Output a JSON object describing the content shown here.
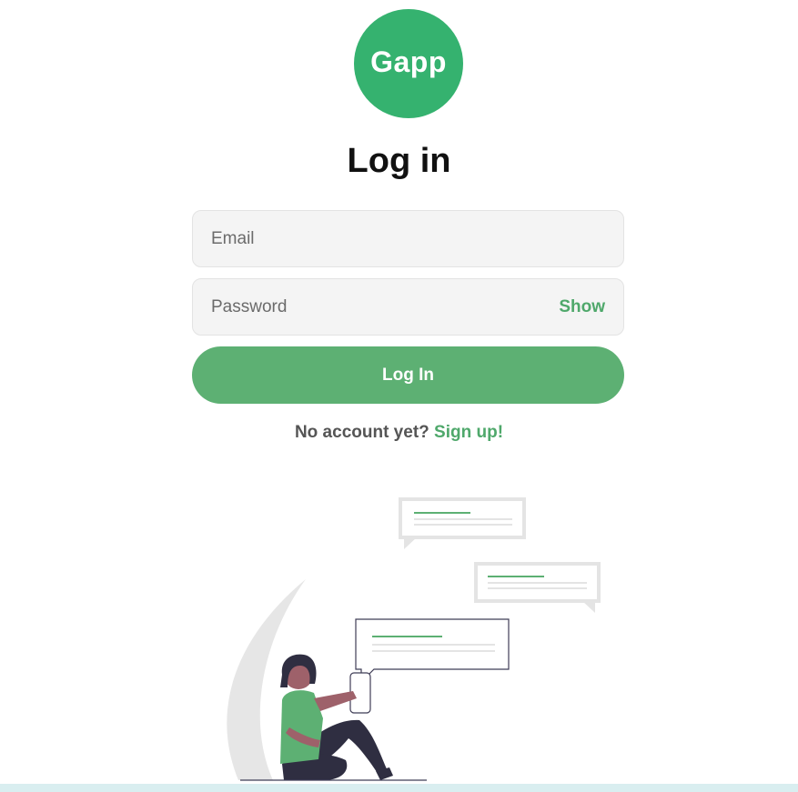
{
  "logo": {
    "text": "Gapp",
    "color": "#35b26f"
  },
  "header": {
    "title": "Log in"
  },
  "form": {
    "email": {
      "placeholder": "Email",
      "value": ""
    },
    "password": {
      "placeholder": "Password",
      "value": "",
      "toggle_label": "Show"
    },
    "submit_label": "Log In"
  },
  "signup": {
    "prompt": "No account yet?",
    "link_label": "Sign up!"
  },
  "colors": {
    "accent": "#5db073",
    "link": "#4fa86b",
    "field_bg": "#f4f4f4"
  },
  "illustration": {
    "icon": "person-texting-illustration"
  }
}
